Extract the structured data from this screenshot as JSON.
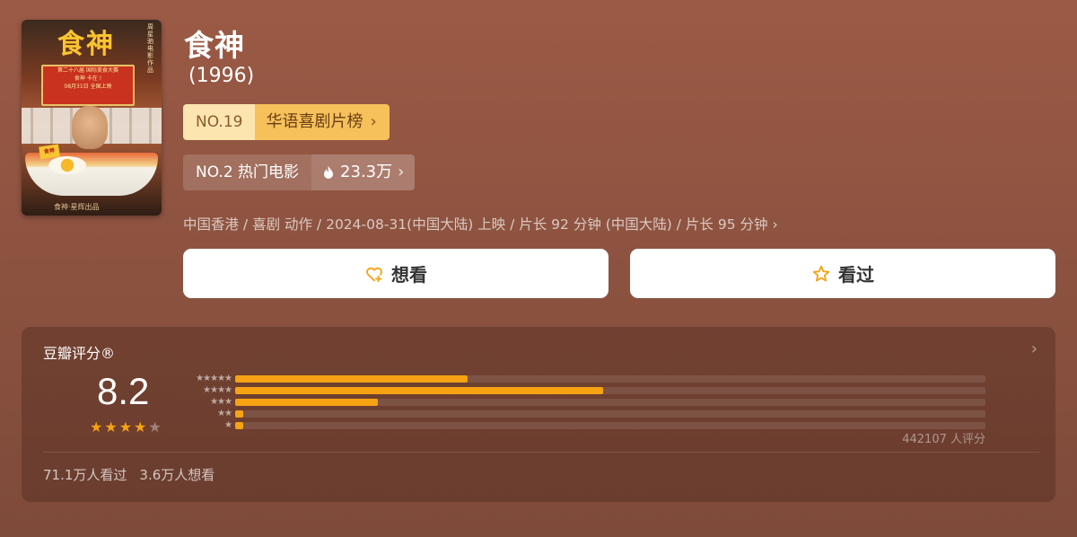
{
  "movie": {
    "title": "食神",
    "year": "(1996)",
    "poster": {
      "title_art": "食神",
      "banner_lines": [
        "第二十八届 国际美食大赛",
        "食神 卡在 !",
        "08月31日 全国上映"
      ],
      "side_text": "周星驰 电影作品",
      "bottom_text": "食神·星辉出品",
      "tag": "食神"
    }
  },
  "rank_primary": {
    "no": "NO.19",
    "name": "华语喜剧片榜"
  },
  "rank_secondary": {
    "no": "NO.2 热门电影",
    "hot_value": "23.3万"
  },
  "meta_line": "中国香港 / 喜剧 动作 / 2024-08-31(中国大陆) 上映 / 片长 92 分钟 (中国大陆) / 片长 95 分钟",
  "actions": {
    "want_label": "想看",
    "seen_label": "看过"
  },
  "rating": {
    "title": "豆瓣评分®",
    "score": "8.2",
    "stars_filled": 4,
    "stars_total": 5,
    "rating_count": "442107 人评分",
    "distribution": [
      {
        "stars": 5,
        "fraction": 0.31
      },
      {
        "stars": 4,
        "fraction": 0.49
      },
      {
        "stars": 3,
        "fraction": 0.19
      },
      {
        "stars": 2,
        "fraction": 0.01
      },
      {
        "stars": 1,
        "fraction": 0.01
      }
    ],
    "seen_count": "71.1万人看过",
    "want_count": "3.6万人想看"
  },
  "colors": {
    "accent": "#f6a213",
    "rank_badge_light": "#fde5b0",
    "rank_badge": "#f6c15a",
    "background": "#8f5441"
  },
  "icons": {
    "hot": "flame-icon",
    "want": "heart-plus-icon",
    "seen": "star-outline-icon"
  }
}
